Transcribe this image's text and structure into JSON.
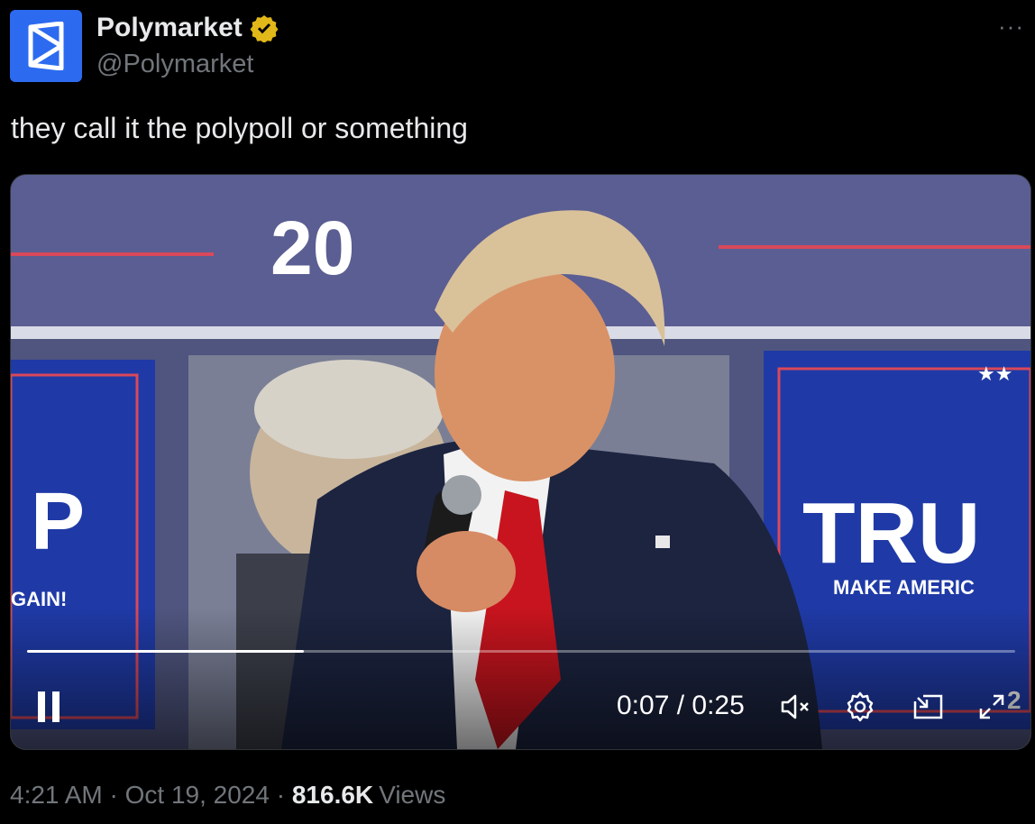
{
  "account": {
    "display_name": "Polymarket",
    "handle": "@Polymarket",
    "avatar_icon": "polymarket-logo-icon",
    "verified_color": "#e2b719"
  },
  "more_label": "···",
  "tweet": {
    "text": "they call it the polypoll or something"
  },
  "video": {
    "scene_text": {
      "banner_year": "20",
      "left_sign_letter": "P",
      "left_sign_slogan": "GAIN!",
      "right_sign_word": "TRU",
      "right_sign_slogan": "MAKE AMERIC",
      "right_sign_stars": "★★",
      "right_sign_corner": "2"
    },
    "current_time": "0:07",
    "duration": "0:25",
    "time_display": "0:07 / 0:25",
    "progress_fraction": 0.28,
    "controls": [
      "pause-icon",
      "mute-icon",
      "settings-icon",
      "picture-in-picture-icon",
      "fullscreen-icon"
    ]
  },
  "meta": {
    "time": "4:21 AM",
    "separator": " · ",
    "date": "Oct 19, 2024",
    "views_count": "816.6K",
    "views_label": "Views"
  }
}
